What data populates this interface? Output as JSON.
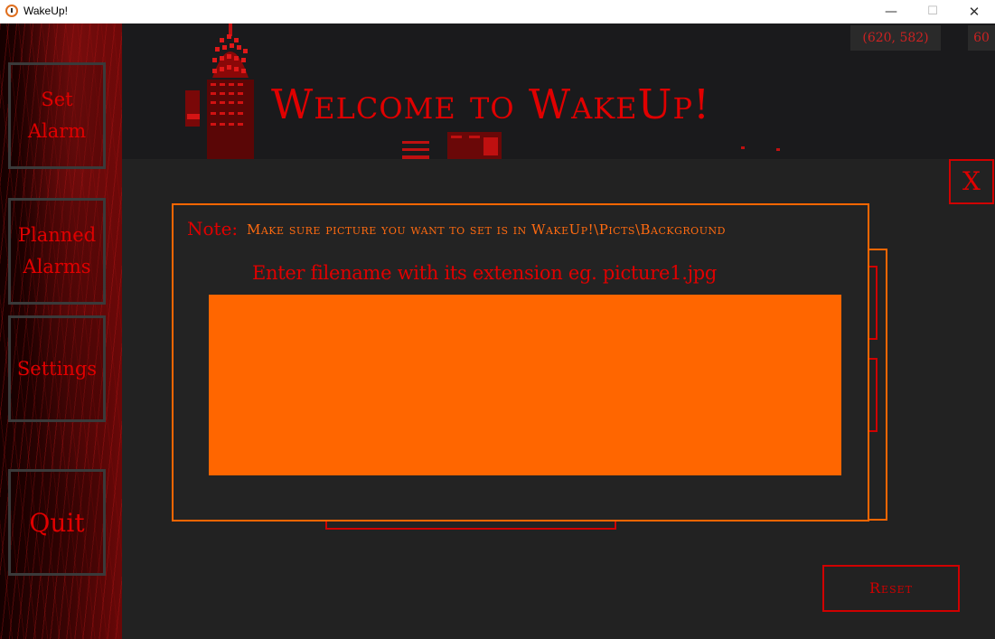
{
  "window": {
    "title": "WakeUp!",
    "minimize_glyph": "—",
    "maximize_glyph": "☐",
    "close_glyph": "✕"
  },
  "sidebar": {
    "items": [
      {
        "label": "Set\nAlarm",
        "name": "set-alarm-button"
      },
      {
        "label": "Planned\nAlarms",
        "name": "planned-alarms-button"
      },
      {
        "label": "Settings",
        "name": "settings-button"
      },
      {
        "label": "Quit",
        "name": "quit-button"
      }
    ]
  },
  "header": {
    "title": "Welcome to WakeUp!",
    "mouse_coords": "(620, 582)",
    "fps": "60"
  },
  "main": {
    "close_label": "X",
    "reset_label": "Reset"
  },
  "dialog": {
    "note_label": "Note:",
    "note_text": "Make sure picture you want to set is in WakeUp!\\Picts\\Background",
    "hint": "Enter filename with its extension eg. picture1.jpg",
    "input_value": ""
  },
  "colors": {
    "accent_red": "#e00000",
    "accent_orange": "#ff6600",
    "background": "#222222",
    "header_bg": "#1a1a1c"
  }
}
